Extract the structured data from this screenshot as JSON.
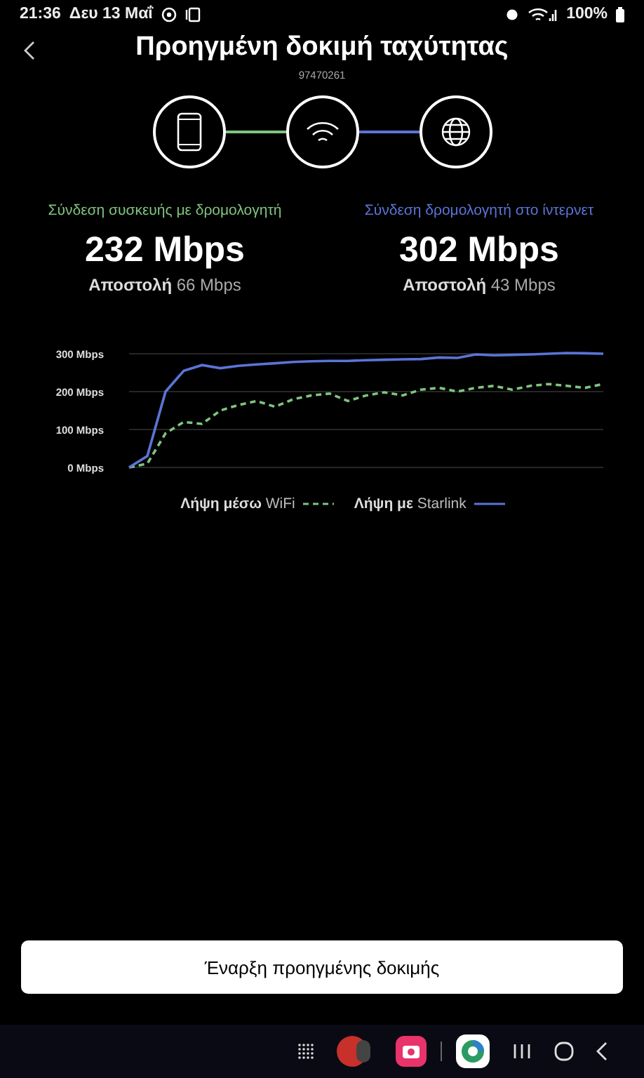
{
  "status_bar": {
    "time": "21:36",
    "date": "Δευ 13 Μαΐ",
    "battery": "100%"
  },
  "header": {
    "title": "Προηγμένη δοκιμή ταχύτητας",
    "subtitle": "97470261"
  },
  "links": [
    {
      "color": "#7fc47f"
    },
    {
      "color": "#5b74d6"
    }
  ],
  "results": [
    {
      "label": "Σύνδεση συσκευής με δρομολογητή",
      "color": "#7fc47f",
      "speed": "232 Mbps",
      "upload": "**Αποστολή** 66 Mbps"
    },
    {
      "label": "Σύνδεση δρομολογητή στο ίντερνετ",
      "color": "#5b74d6",
      "speed": "302 Mbps",
      "upload": "**Αποστολή** 43 Mbps"
    }
  ],
  "chart": {
    "chart_data": {
      "type": "line",
      "grid": true,
      "legend": "bottom",
      "ylim": [
        0,
        310
      ],
      "yticks": [
        {
          "value": 0,
          "label": "0 Mbps"
        },
        {
          "value": 100,
          "label": "100 Mbps"
        },
        {
          "value": 200,
          "label": "200 Mbps"
        },
        {
          "value": 300,
          "label": "300 Mbps"
        }
      ],
      "series": [
        {
          "name": "**Λήψη μέσω** WiFi",
          "color": "#7fc47f",
          "line_style": "dashed",
          "values": [
            0,
            10,
            90,
            120,
            115,
            150,
            165,
            175,
            160,
            180,
            190,
            195,
            175,
            190,
            198,
            190,
            205,
            210,
            200,
            210,
            215,
            205,
            215,
            220,
            215,
            210,
            220
          ]
        },
        {
          "name": "**Λήψη με** Starlink",
          "color": "#5b74d6",
          "line_style": "solid",
          "values": [
            0,
            30,
            200,
            255,
            270,
            262,
            268,
            272,
            275,
            278,
            280,
            281,
            281,
            283,
            284,
            285,
            286,
            290,
            289,
            298,
            296,
            297,
            298,
            300,
            302,
            301,
            300
          ]
        }
      ]
    }
  },
  "start_button": "Έναρξη προηγμένης δοκιμής"
}
